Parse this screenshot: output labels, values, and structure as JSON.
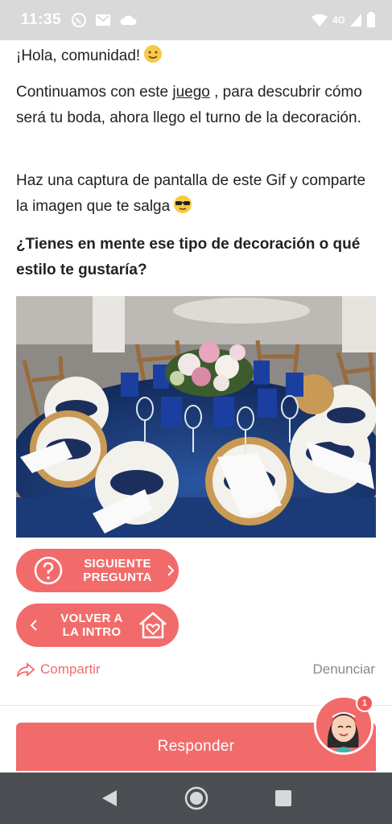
{
  "status_bar": {
    "time": "11:35",
    "network": "4G",
    "icons": [
      "whatsapp-icon",
      "gmail-icon",
      "cloud-icon",
      "wifi-icon",
      "signal-icon",
      "battery-icon"
    ]
  },
  "post": {
    "greeting": "¡Hola, comunidad!",
    "para2_before": "Continuamos con este ",
    "para2_link": "juego",
    "para2_after": " , para descubrir cómo será tu boda, ahora llego el turno de la decoración.",
    "para3": "Haz una captura de pantalla de este Gif y comparte la imagen que te salga",
    "question": "¿Tienes en mente ese tipo de decoración o qué estilo te gustaría?"
  },
  "actions": {
    "next_line1": "SIGUIENTE",
    "next_line2": "PREGUNTA",
    "back_line1": "VOLVER A",
    "back_line2": "LA INTRO",
    "share": "Compartir",
    "report": "Denunciar",
    "respond": "Responder",
    "notification_count": "1"
  },
  "colors": {
    "accent": "#f26b6b",
    "status_bar": "#d9d9d9",
    "nav_bar": "#4b4f54",
    "tablecloth": "#1e3d7a"
  }
}
